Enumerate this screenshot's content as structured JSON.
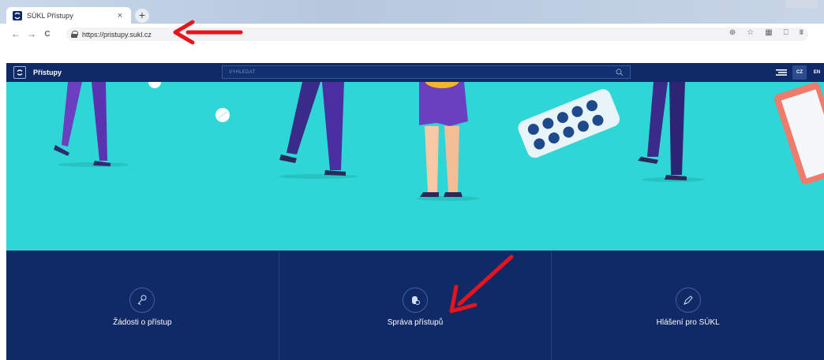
{
  "browser": {
    "tab_title": "SÚKL Přístupy",
    "tab_close": "×",
    "new_tab": "+",
    "back": "←",
    "forward": "→",
    "reload": "C",
    "url": "https://pristupy.sukl.cz",
    "actions": [
      "⊕",
      "☆",
      "▦",
      "⎕",
      "⩩"
    ]
  },
  "site": {
    "title": "Přístupy",
    "search_placeholder": "VYHLEDAT",
    "lang_cz": "CZ",
    "lang_en": "EN",
    "tiles": [
      {
        "label": "Žádosti o přístup",
        "icon": "key-icon"
      },
      {
        "label": "Správa přístupů",
        "icon": "access-icon"
      },
      {
        "label": "Hlášení pro SÚKL",
        "icon": "report-icon"
      }
    ]
  },
  "colors": {
    "header": "#0f2a66",
    "hero": "#2fd6d6",
    "accent_arrow": "#e8141b"
  }
}
